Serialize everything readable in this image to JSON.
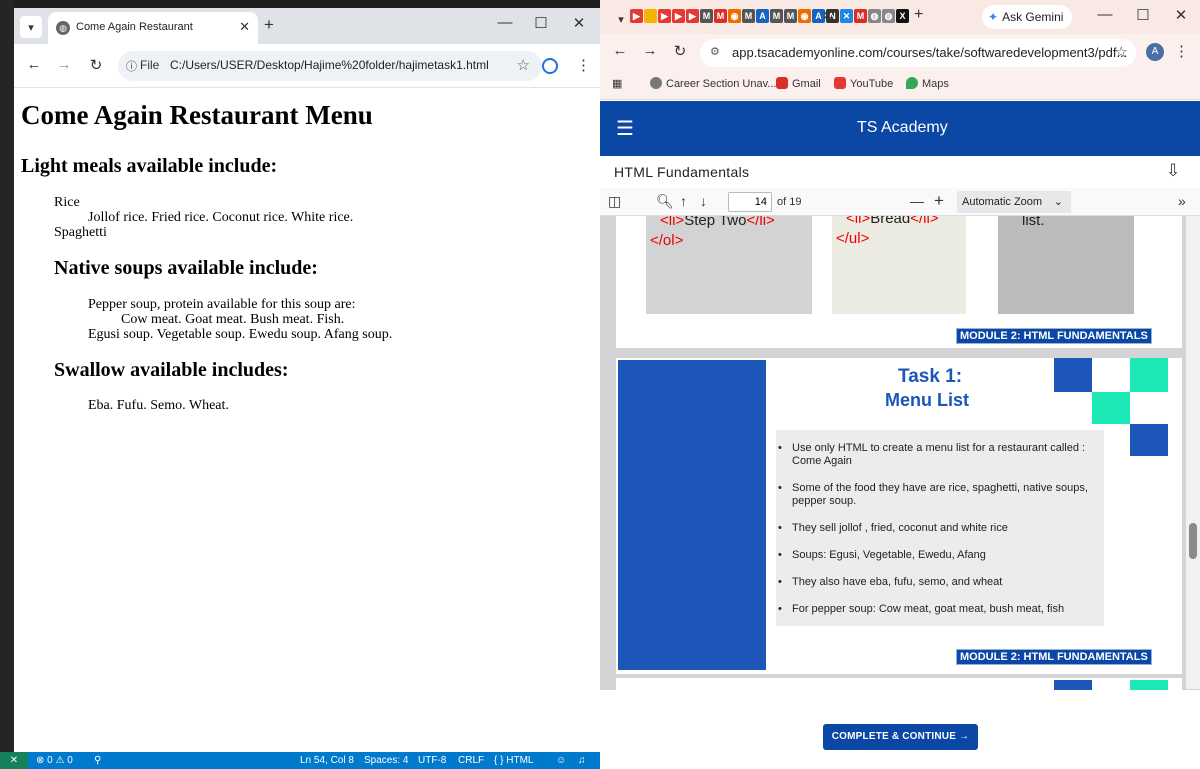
{
  "left_browser": {
    "tab_title": "Come Again Restaurant",
    "file_label": "File",
    "url": "C:/Users/USER/Desktop/Hajime%20folder/hajimetask1.html"
  },
  "left_page": {
    "title": "Come Again Restaurant Menu",
    "light_heading": "Light meals available include:",
    "rice": "Rice",
    "rice_items": "Jollof rice. Fried rice. Coconut rice. White rice.",
    "spaghetti": "Spaghetti",
    "native_heading": "Native soups available include:",
    "pepper_soup": "Pepper soup, protein available for this soup are:",
    "pepper_proteins": "Cow meat. Goat meat. Bush meat. Fish.",
    "other_soups": "Egusi soup. Vegetable soup. Ewedu soup. Afang soup.",
    "swallow_heading": "Swallow available includes:",
    "swallow_items": "Eba. Fufu. Semo. Wheat."
  },
  "right_browser": {
    "gemini_label": "Ask Gemini",
    "url": "app.tsacademyonline.com/courses/take/softwaredevelopment3/pdf...",
    "avatar_letter": "A",
    "bookmarks": [
      {
        "label": "Career Section Unav...",
        "icon": "globe-icon"
      },
      {
        "label": "Gmail",
        "icon": "gmail-icon"
      },
      {
        "label": "YouTube",
        "icon": "youtube-icon"
      },
      {
        "label": "Maps",
        "icon": "maps-icon"
      }
    ]
  },
  "ts_academy": {
    "brand": "TS Academy",
    "course_title": "HTML Fundamentals",
    "complete_button": "COMPLETE & CONTINUE →"
  },
  "pdf": {
    "current_page": "14",
    "page_count": "of 19",
    "zoom": "Automatic Zoom",
    "module_label": "MODULE 2: HTML FUNDAMENTALS",
    "snippet_step_two": "Step Two",
    "snippet_bread": "Bread",
    "snippet_list": "list.",
    "task_title": "Task 1:",
    "task_subtitle": "Menu List",
    "bullets": [
      "Use only HTML to create a menu list for a restaurant called : Come Again",
      "Some of the food they have are rice, spaghetti, native soups, pepper soup.",
      "They sell jollof , fried, coconut and white rice",
      "Soups: Egusi, Vegetable, Ewedu, Afang",
      "They also have eba, fufu, semo, and wheat",
      "For pepper soup: Cow meat, goat meat, bush meat, fish"
    ]
  },
  "statusbar": {
    "problems": "⊗ 0 ⚠ 0",
    "position": "Ln 54, Col 8",
    "spaces": "Spaces: 4",
    "encoding": "UTF-8",
    "eol": "CRLF",
    "language": "{ } HTML"
  },
  "colors": {
    "ts_blue": "#0b48a6",
    "accent_green": "#1de9b6",
    "code_red": "#e00000"
  }
}
